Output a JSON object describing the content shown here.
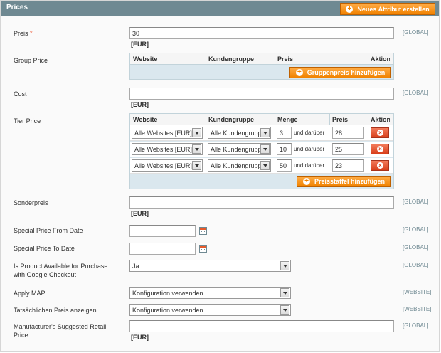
{
  "header": {
    "title": "Prices",
    "new_attribute_button": "Neues Attribut erstellen"
  },
  "fields": {
    "price": {
      "label": "Preis",
      "required_mark": "*",
      "value": "30",
      "unit": "[EUR]",
      "scope": "[GLOBAL]"
    },
    "group_price": {
      "label": "Group Price",
      "columns": [
        "Website",
        "Kundengruppe",
        "Preis",
        "Aktion"
      ],
      "add_button": "Gruppenpreis hinzufügen"
    },
    "cost": {
      "label": "Cost",
      "value": "",
      "unit": "[EUR]",
      "scope": "[GLOBAL]"
    },
    "tier_price": {
      "label": "Tier Price",
      "columns": [
        "Website",
        "Kundengruppe",
        "Menge",
        "Preis",
        "Aktion"
      ],
      "rows": [
        {
          "website": "Alle Websites [EUR]",
          "group": "Alle Kundengruppen",
          "qty": "3",
          "qty_suffix": "und darüber",
          "price": "28"
        },
        {
          "website": "Alle Websites [EUR]",
          "group": "Alle Kundengruppen",
          "qty": "10",
          "qty_suffix": "und darüber",
          "price": "25"
        },
        {
          "website": "Alle Websites [EUR]",
          "group": "Alle Kundengruppen",
          "qty": "50",
          "qty_suffix": "und darüber",
          "price": "23"
        }
      ],
      "add_button": "Preisstaffel hinzufügen"
    },
    "special_price": {
      "label": "Sonderpreis",
      "value": "",
      "unit": "[EUR]",
      "scope": "[GLOBAL]"
    },
    "special_from": {
      "label": "Special Price From Date",
      "value": "",
      "scope": "[GLOBAL]"
    },
    "special_to": {
      "label": "Special Price To Date",
      "value": "",
      "scope": "[GLOBAL]"
    },
    "google_checkout": {
      "label_line1": "Is Product Available for Purchase",
      "label_line2": "with Google Checkout",
      "value": "Ja",
      "scope": "[GLOBAL]"
    },
    "apply_map": {
      "label": "Apply MAP",
      "value": "Konfiguration verwenden",
      "scope": "[WEBSITE]"
    },
    "show_price": {
      "label": "Tatsächlichen Preis anzeigen",
      "value": "Konfiguration verwenden",
      "scope": "[WEBSITE]"
    },
    "msrp": {
      "label_line1": "Manufacturer's Suggested Retail",
      "label_line2": "Price",
      "value": "",
      "unit": "[EUR]",
      "scope": "[GLOBAL]"
    }
  }
}
